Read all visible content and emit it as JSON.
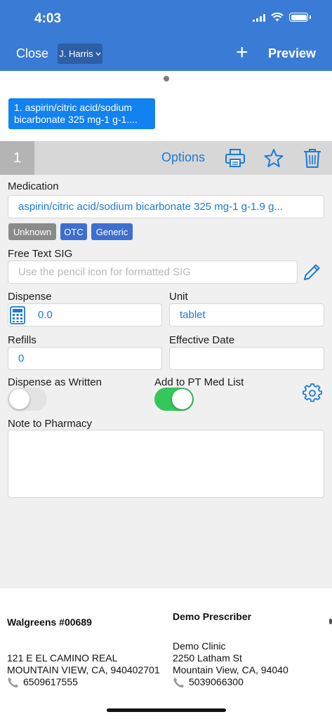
{
  "status_bar": {
    "time": "4:03"
  },
  "nav": {
    "close_label": "Close",
    "user_label": "J. Harris",
    "add_label": "+",
    "preview_label": "Preview"
  },
  "med_chip": {
    "text": "1. aspirin/citric acid/sodium bicarbonate 325 mg-1 g-1...."
  },
  "rx": {
    "number": "1",
    "options_label": "Options",
    "medication_label": "Medication",
    "medication_value": "aspirin/citric acid/sodium bicarbonate 325 mg-1 g-1.9 g...",
    "badges": [
      {
        "label": "Unknown",
        "color": "#8a8a8a"
      },
      {
        "label": "OTC",
        "color": "#3d6fd1"
      },
      {
        "label": "Generic",
        "color": "#3d6fd1"
      }
    ],
    "sig_label": "Free Text SIG",
    "sig_placeholder": "Use the pencil icon for formatted SIG",
    "dispense_label": "Dispense",
    "dispense_value": "0.0",
    "unit_label": "Unit",
    "unit_value": "tablet",
    "refills_label": "Refills",
    "refills_value": "0",
    "effective_date_label": "Effective Date",
    "effective_date_value": "",
    "daw_label": "Dispense as Written",
    "daw_on": false,
    "add_med_list_label": "Add to PT Med List",
    "add_med_list_on": true,
    "note_label": "Note to Pharmacy",
    "note_value": ""
  },
  "pharmacy": {
    "name": "Walgreens #00689",
    "address1": "121 E EL CAMINO REAL",
    "address2": "MOUNTAIN VIEW, CA, 940402701",
    "phone": "6509617555"
  },
  "prescriber": {
    "name": "Demo Prescriber",
    "clinic": "Demo Clinic",
    "address1": "2250 Latham St",
    "address2": "Mountain View, CA, 94040",
    "phone": "5039066300"
  },
  "colors": {
    "nav_bar": "#3a7bd5",
    "accent": "#1a7ad9",
    "toggle_on": "#34c759",
    "toggle_off": "#e5e5e5"
  }
}
